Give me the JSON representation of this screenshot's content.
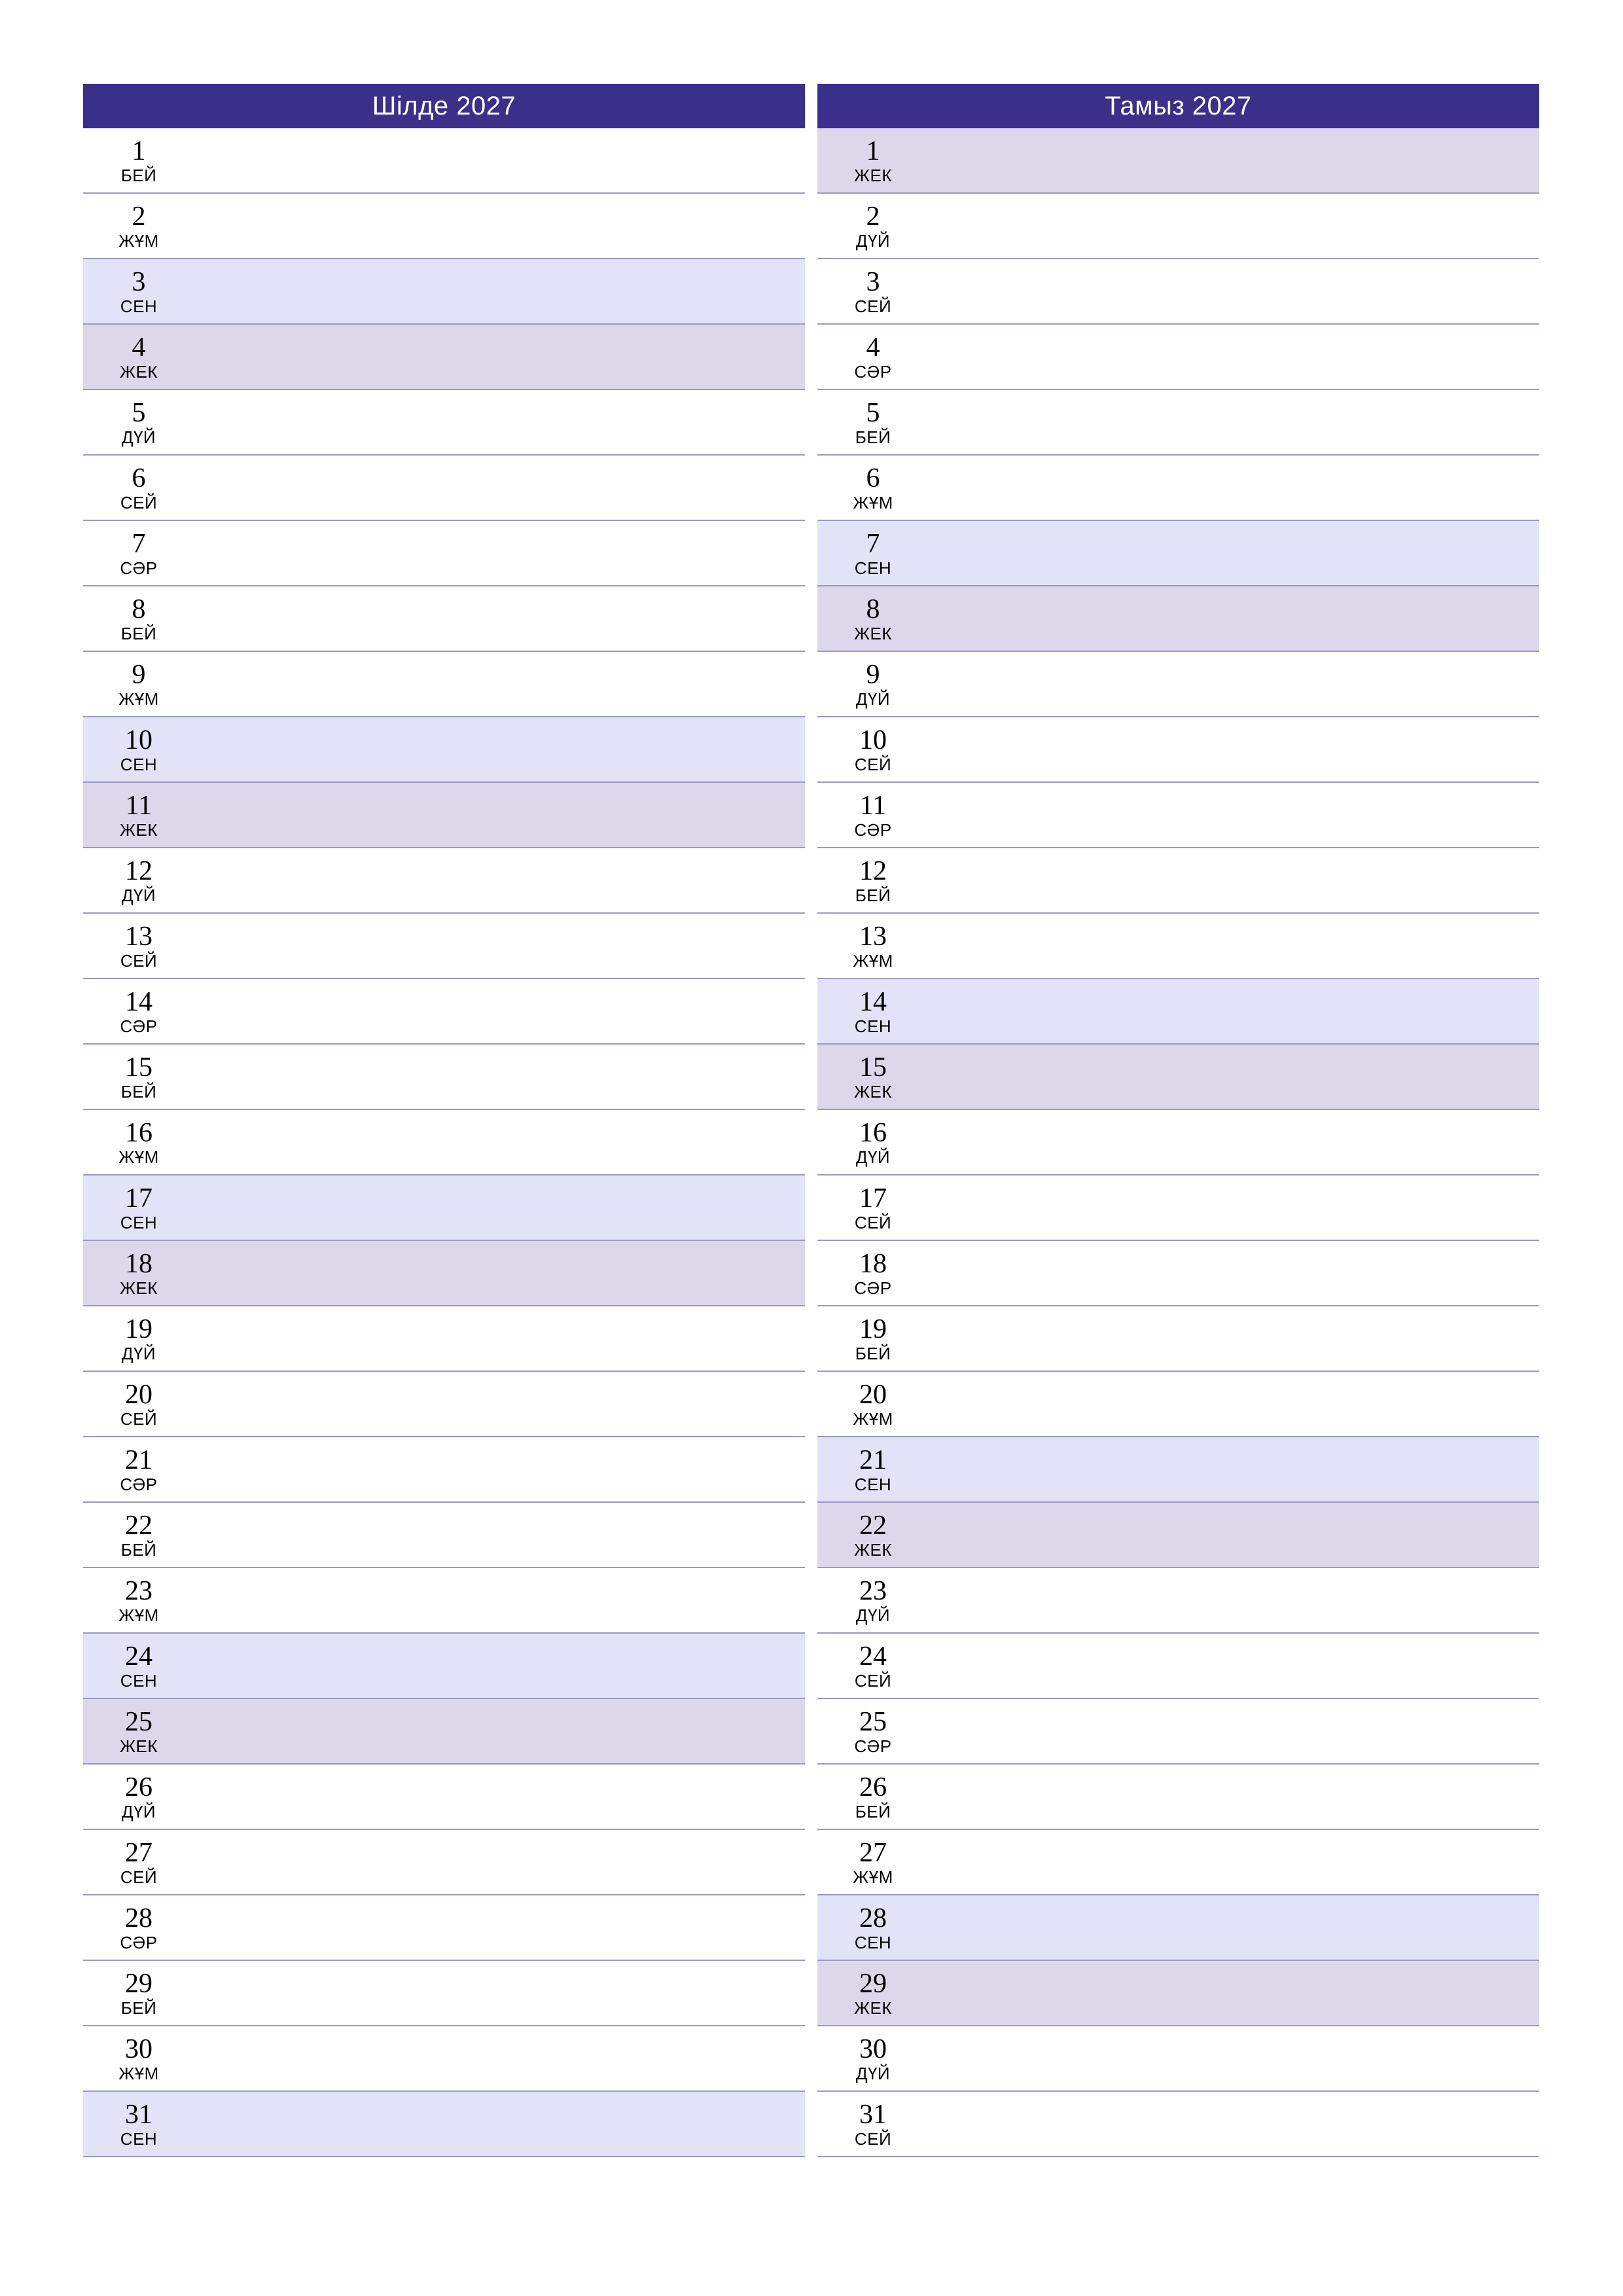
{
  "page": {
    "type": "monthly-planner",
    "orientation": "portrait",
    "language": "kk",
    "colors": {
      "header_background": "#3a3089",
      "header_text": "#ffffff",
      "saturday_background": "#e3e3f7",
      "sunday_background": "#dcd8ea",
      "row_divider": "#9b99c0",
      "day_text": "#000000",
      "page_background": "#ffffff"
    }
  },
  "months": [
    {
      "title": "Шілде 2027",
      "days": [
        {
          "num": "1",
          "weekday": "БЕЙ",
          "type": "weekday"
        },
        {
          "num": "2",
          "weekday": "ЖҰМ",
          "type": "weekday"
        },
        {
          "num": "3",
          "weekday": "СЕН",
          "type": "saturday"
        },
        {
          "num": "4",
          "weekday": "ЖЕК",
          "type": "sunday"
        },
        {
          "num": "5",
          "weekday": "ДҮЙ",
          "type": "weekday"
        },
        {
          "num": "6",
          "weekday": "СЕЙ",
          "type": "weekday"
        },
        {
          "num": "7",
          "weekday": "СӘР",
          "type": "weekday"
        },
        {
          "num": "8",
          "weekday": "БЕЙ",
          "type": "weekday"
        },
        {
          "num": "9",
          "weekday": "ЖҰМ",
          "type": "weekday"
        },
        {
          "num": "10",
          "weekday": "СЕН",
          "type": "saturday"
        },
        {
          "num": "11",
          "weekday": "ЖЕК",
          "type": "sunday"
        },
        {
          "num": "12",
          "weekday": "ДҮЙ",
          "type": "weekday"
        },
        {
          "num": "13",
          "weekday": "СЕЙ",
          "type": "weekday"
        },
        {
          "num": "14",
          "weekday": "СӘР",
          "type": "weekday"
        },
        {
          "num": "15",
          "weekday": "БЕЙ",
          "type": "weekday"
        },
        {
          "num": "16",
          "weekday": "ЖҰМ",
          "type": "weekday"
        },
        {
          "num": "17",
          "weekday": "СЕН",
          "type": "saturday"
        },
        {
          "num": "18",
          "weekday": "ЖЕК",
          "type": "sunday"
        },
        {
          "num": "19",
          "weekday": "ДҮЙ",
          "type": "weekday"
        },
        {
          "num": "20",
          "weekday": "СЕЙ",
          "type": "weekday"
        },
        {
          "num": "21",
          "weekday": "СӘР",
          "type": "weekday"
        },
        {
          "num": "22",
          "weekday": "БЕЙ",
          "type": "weekday"
        },
        {
          "num": "23",
          "weekday": "ЖҰМ",
          "type": "weekday"
        },
        {
          "num": "24",
          "weekday": "СЕН",
          "type": "saturday"
        },
        {
          "num": "25",
          "weekday": "ЖЕК",
          "type": "sunday"
        },
        {
          "num": "26",
          "weekday": "ДҮЙ",
          "type": "weekday"
        },
        {
          "num": "27",
          "weekday": "СЕЙ",
          "type": "weekday"
        },
        {
          "num": "28",
          "weekday": "СӘР",
          "type": "weekday"
        },
        {
          "num": "29",
          "weekday": "БЕЙ",
          "type": "weekday"
        },
        {
          "num": "30",
          "weekday": "ЖҰМ",
          "type": "weekday"
        },
        {
          "num": "31",
          "weekday": "СЕН",
          "type": "saturday"
        }
      ]
    },
    {
      "title": "Тамыз 2027",
      "days": [
        {
          "num": "1",
          "weekday": "ЖЕК",
          "type": "sunday"
        },
        {
          "num": "2",
          "weekday": "ДҮЙ",
          "type": "weekday"
        },
        {
          "num": "3",
          "weekday": "СЕЙ",
          "type": "weekday"
        },
        {
          "num": "4",
          "weekday": "СӘР",
          "type": "weekday"
        },
        {
          "num": "5",
          "weekday": "БЕЙ",
          "type": "weekday"
        },
        {
          "num": "6",
          "weekday": "ЖҰМ",
          "type": "weekday"
        },
        {
          "num": "7",
          "weekday": "СЕН",
          "type": "saturday"
        },
        {
          "num": "8",
          "weekday": "ЖЕК",
          "type": "sunday"
        },
        {
          "num": "9",
          "weekday": "ДҮЙ",
          "type": "weekday"
        },
        {
          "num": "10",
          "weekday": "СЕЙ",
          "type": "weekday"
        },
        {
          "num": "11",
          "weekday": "СӘР",
          "type": "weekday"
        },
        {
          "num": "12",
          "weekday": "БЕЙ",
          "type": "weekday"
        },
        {
          "num": "13",
          "weekday": "ЖҰМ",
          "type": "weekday"
        },
        {
          "num": "14",
          "weekday": "СЕН",
          "type": "saturday"
        },
        {
          "num": "15",
          "weekday": "ЖЕК",
          "type": "sunday"
        },
        {
          "num": "16",
          "weekday": "ДҮЙ",
          "type": "weekday"
        },
        {
          "num": "17",
          "weekday": "СЕЙ",
          "type": "weekday"
        },
        {
          "num": "18",
          "weekday": "СӘР",
          "type": "weekday"
        },
        {
          "num": "19",
          "weekday": "БЕЙ",
          "type": "weekday"
        },
        {
          "num": "20",
          "weekday": "ЖҰМ",
          "type": "weekday"
        },
        {
          "num": "21",
          "weekday": "СЕН",
          "type": "saturday"
        },
        {
          "num": "22",
          "weekday": "ЖЕК",
          "type": "sunday"
        },
        {
          "num": "23",
          "weekday": "ДҮЙ",
          "type": "weekday"
        },
        {
          "num": "24",
          "weekday": "СЕЙ",
          "type": "weekday"
        },
        {
          "num": "25",
          "weekday": "СӘР",
          "type": "weekday"
        },
        {
          "num": "26",
          "weekday": "БЕЙ",
          "type": "weekday"
        },
        {
          "num": "27",
          "weekday": "ЖҰМ",
          "type": "weekday"
        },
        {
          "num": "28",
          "weekday": "СЕН",
          "type": "saturday"
        },
        {
          "num": "29",
          "weekday": "ЖЕК",
          "type": "sunday"
        },
        {
          "num": "30",
          "weekday": "ДҮЙ",
          "type": "weekday"
        },
        {
          "num": "31",
          "weekday": "СЕЙ",
          "type": "weekday"
        }
      ]
    }
  ]
}
